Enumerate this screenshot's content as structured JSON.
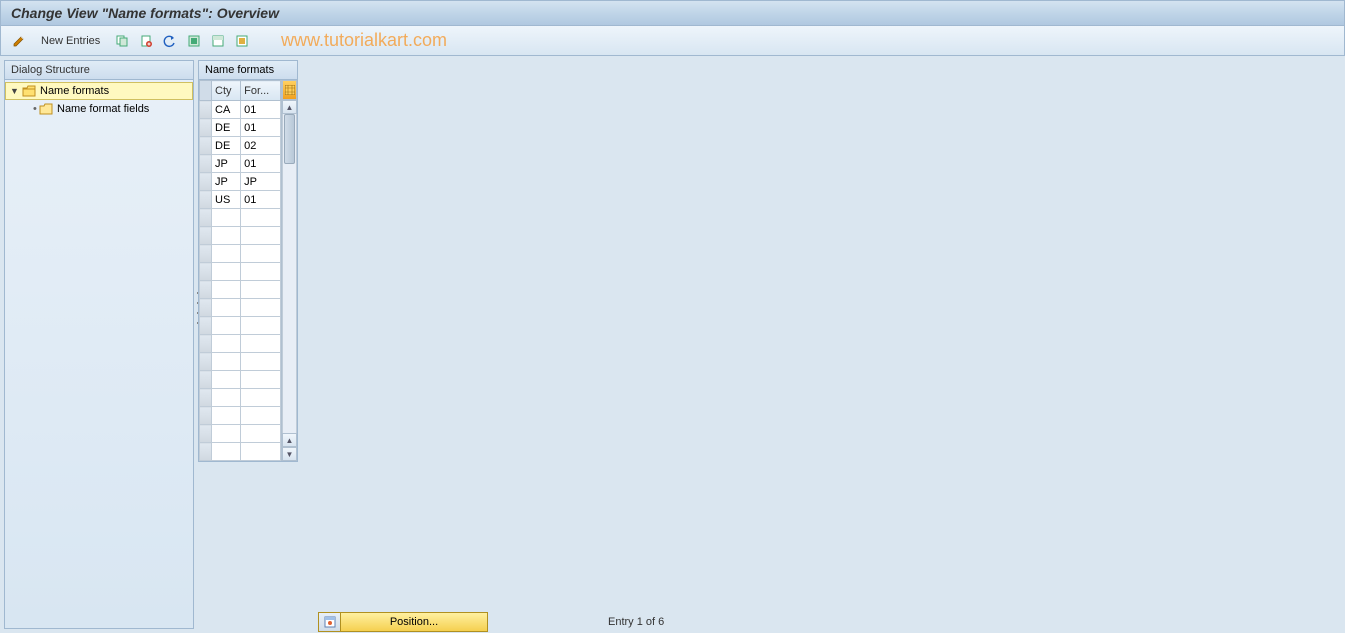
{
  "title": "Change View \"Name formats\": Overview",
  "watermark": "www.tutorialkart.com",
  "toolbar": {
    "new_entries": "New Entries"
  },
  "dialog_structure": {
    "header": "Dialog Structure",
    "root": "Name formats",
    "child": "Name format fields"
  },
  "grid": {
    "title": "Name formats",
    "columns": {
      "cty": "Cty",
      "format": "For..."
    },
    "rows": [
      {
        "cty": "CA",
        "fmt": "01"
      },
      {
        "cty": "DE",
        "fmt": "01"
      },
      {
        "cty": "DE",
        "fmt": "02"
      },
      {
        "cty": "JP",
        "fmt": "01"
      },
      {
        "cty": "JP",
        "fmt": "JP"
      },
      {
        "cty": "US",
        "fmt": "01"
      }
    ],
    "empty_rows": 14
  },
  "footer": {
    "position_label": "Position...",
    "entry_status": "Entry 1 of 6"
  },
  "colors": {
    "accent_yellow": "#f5d050",
    "panel_bg": "#dae6f0"
  }
}
